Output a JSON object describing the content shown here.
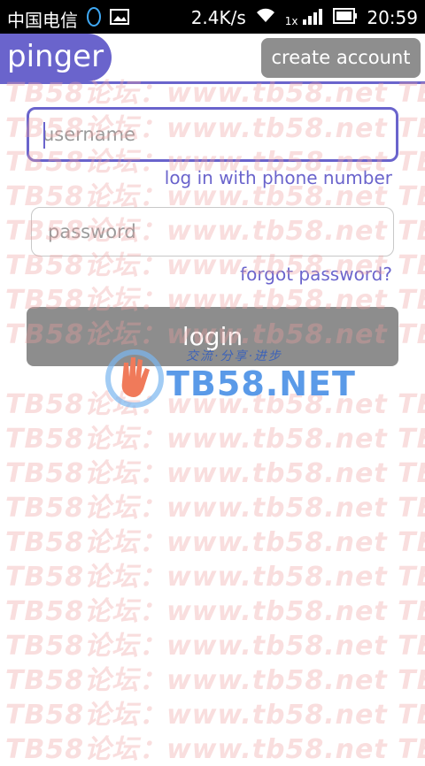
{
  "status_bar": {
    "carrier": "中国电信",
    "speed": "2.4K/s",
    "network": "1x",
    "time": "20:59"
  },
  "header": {
    "logo_text": "pinger",
    "create_account_label": "create account"
  },
  "form": {
    "username_placeholder": "username",
    "phone_login_link": "log in with phone number",
    "password_placeholder": "password",
    "forgot_link": "forgot password?",
    "login_label": "login"
  },
  "watermark": {
    "text": "TB58论坛：www.tb58.net TB58",
    "logo_text": "TB58.NET",
    "slogan": "交流·分享·进步"
  },
  "colors": {
    "accent": "#6a64cc",
    "button_gray": "#8d8d8d"
  }
}
